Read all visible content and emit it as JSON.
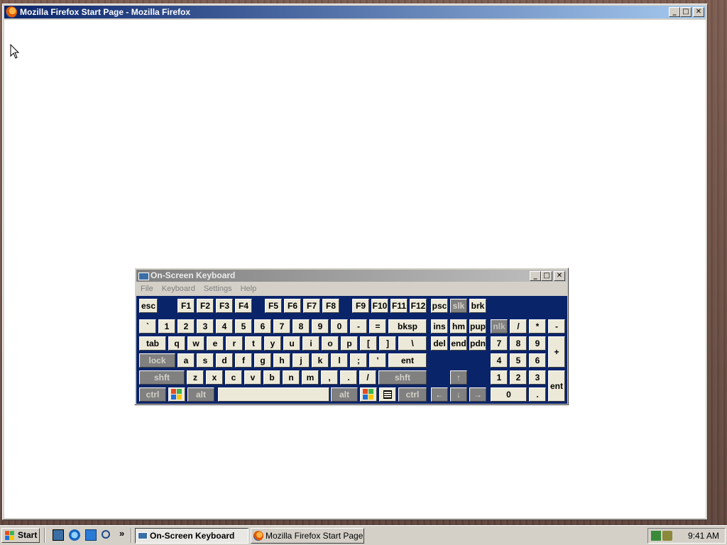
{
  "firefox": {
    "title": "Mozilla Firefox Start Page - Mozilla Firefox",
    "buttons": {
      "minimize": "_",
      "maximize": "□",
      "close": "✕"
    }
  },
  "osk": {
    "title": "On-Screen Keyboard",
    "menu": [
      "File",
      "Keyboard",
      "Settings",
      "Help"
    ],
    "buttons": {
      "minimize": "_",
      "maximize": "□",
      "close": "✕"
    },
    "keys": {
      "esc": "esc",
      "f1": "F1",
      "f2": "F2",
      "f3": "F3",
      "f4": "F4",
      "f5": "F5",
      "f6": "F6",
      "f7": "F7",
      "f8": "F8",
      "f9": "F9",
      "f10": "F10",
      "f11": "F11",
      "f12": "F12",
      "psc": "psc",
      "slk": "slk",
      "brk": "brk",
      "backtick": "`",
      "n1": "1",
      "n2": "2",
      "n3": "3",
      "n4": "4",
      "n5": "5",
      "n6": "6",
      "n7": "7",
      "n8": "8",
      "n9": "9",
      "n0": "0",
      "minus": "-",
      "equals": "=",
      "bksp": "bksp",
      "ins": "ins",
      "hm": "hm",
      "pup": "pup",
      "nlk": "nlk",
      "kp_div": "/",
      "kp_mul": "*",
      "kp_minus": "-",
      "tab": "tab",
      "q": "q",
      "w": "w",
      "e": "e",
      "r": "r",
      "t": "t",
      "y": "y",
      "u": "u",
      "i": "i",
      "o": "o",
      "p": "p",
      "lbracket": "[",
      "rbracket": "]",
      "backslash": "\\",
      "del": "del",
      "end": "end",
      "pdn": "pdn",
      "kp7": "7",
      "kp8": "8",
      "kp9": "9",
      "kp_plus": "+",
      "lock": "lock",
      "a": "a",
      "s": "s",
      "d": "d",
      "f": "f",
      "g": "g",
      "h": "h",
      "j": "j",
      "k": "k",
      "l": "l",
      "semicolon": ";",
      "quote": "'",
      "ent": "ent",
      "kp4": "4",
      "kp5": "5",
      "kp6": "6",
      "lshft": "shft",
      "z": "z",
      "x": "x",
      "c": "c",
      "v": "v",
      "b": "b",
      "n": "n",
      "m": "m",
      "comma": ",",
      "period": ".",
      "slash": "/",
      "rshft": "shft",
      "up": "↑",
      "kp1": "1",
      "kp2": "2",
      "kp3": "3",
      "kp_ent": "ent",
      "lctrl": "ctrl",
      "lalt": "alt",
      "space": "",
      "ralt": "alt",
      "rctrl": "ctrl",
      "left": "←",
      "down": "↓",
      "right": "→",
      "kp0": "0",
      "kp_dot": "."
    }
  },
  "taskbar": {
    "start": "Start",
    "more": "»",
    "tasks": [
      {
        "label": "On-Screen Keyboard",
        "active": true
      },
      {
        "label": "Mozilla Firefox Start Page...",
        "active": false
      }
    ],
    "clock": "9:41 AM"
  },
  "colors": {
    "title_active": "#0a246a",
    "title_inactive": "#808080",
    "osk_bg": "#0a246a",
    "key_face": "#ece9d8",
    "key_dim": "#808080"
  }
}
